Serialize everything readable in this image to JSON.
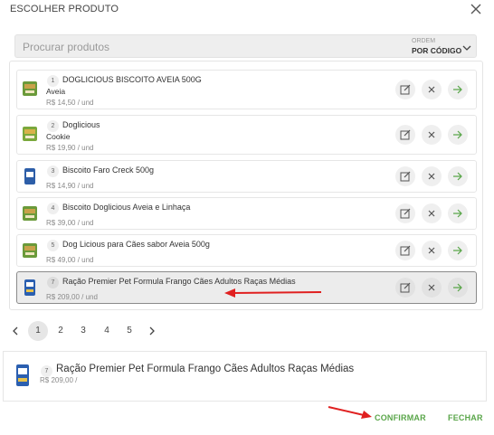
{
  "dialog": {
    "title": "ESCOLHER PRODUTO",
    "close_icon": "close-icon"
  },
  "search": {
    "placeholder": "Procurar produtos",
    "value": "",
    "order_label": "ORDEM",
    "order_value": "POR CÓDIGO"
  },
  "products": [
    {
      "code": "1",
      "name": "DOGLICIOUS BISCOITO AVEIA 500G",
      "variant": "Aveia",
      "price": "R$ 14,50 / und",
      "thumb_color": "#6a9a3a"
    },
    {
      "code": "2",
      "name": "Doglicious",
      "variant": "Cookie",
      "price": "R$ 19,90 / und",
      "thumb_color": "#7aa83c"
    },
    {
      "code": "3",
      "name": "Biscoito Faro Creck 500g",
      "variant": "",
      "price": "R$ 14,90 / und",
      "thumb_color": "#2d5ea8"
    },
    {
      "code": "4",
      "name": "Biscoito Doglicious Aveia e Linhaça",
      "variant": "",
      "price": "R$ 39,00 / und",
      "thumb_color": "#6a9a3a"
    },
    {
      "code": "5",
      "name": "Dog Licious para Cães sabor Aveia 500g",
      "variant": "",
      "price": "R$ 49,00 / und",
      "thumb_color": "#6a9a3a"
    },
    {
      "code": "7",
      "name": "Ração Premier Pet Formula Frango Cães Adultos Raças Médias",
      "variant": "",
      "price": "R$ 209,00 / und",
      "thumb_color": "#2b5fb0"
    }
  ],
  "pagination": {
    "pages": [
      "1",
      "2",
      "3",
      "4",
      "5"
    ],
    "current": "1"
  },
  "selected": {
    "code": "7",
    "name": "Ração Premier Pet Formula Frango Cães Adultos Raças Médias",
    "price": "R$ 209,00 /"
  },
  "actions": {
    "confirm_label": "CONFIRMAR",
    "close_label": "FECHAR"
  },
  "colors": {
    "accent_green": "#5aa64a",
    "annotation_red": "#e02020"
  }
}
